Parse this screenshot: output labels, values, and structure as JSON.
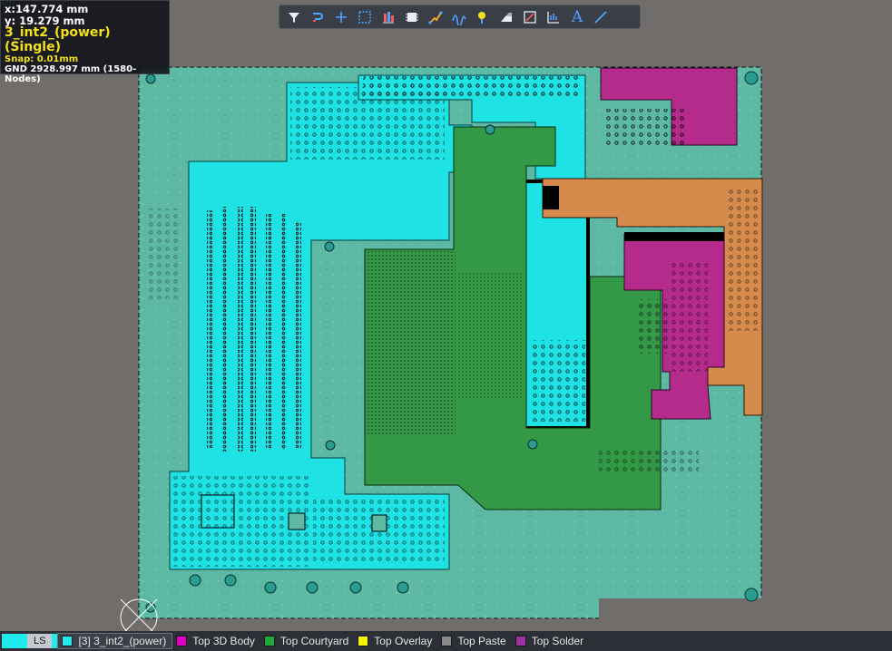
{
  "hud": {
    "x": "x:147.774 mm",
    "y": "y: 19.279  mm",
    "layer": "3_int2_(power) (Single)",
    "snap": "Snap: 0.01mm",
    "net": "GND  2928.997 mm  (1580-Nodes)"
  },
  "toolbar": {
    "items": [
      {
        "icon": "filter-icon"
      },
      {
        "icon": "route-icon"
      },
      {
        "icon": "crosshair-icon"
      },
      {
        "icon": "select-rect-icon"
      },
      {
        "icon": "align-icon"
      },
      {
        "icon": "component-icon"
      },
      {
        "icon": "interactive-route-icon"
      },
      {
        "icon": "diff-pair-icon"
      },
      {
        "icon": "place-via-icon"
      },
      {
        "icon": "polygon-icon"
      },
      {
        "icon": "dimension-icon"
      },
      {
        "icon": "graph-icon"
      },
      {
        "icon": "text-icon"
      },
      {
        "icon": "line-icon"
      }
    ],
    "text_icon_glyph": "A"
  },
  "statusbar": {
    "ls_label": "LS",
    "tabs": [
      {
        "label": "[3] 3_int2_(power)",
        "color": "#20ebea",
        "active": true
      },
      {
        "label": "Top 3D Body",
        "color": "#e000c8"
      },
      {
        "label": "Top Courtyard",
        "color": "#22a83a"
      },
      {
        "label": "Top Overlay",
        "color": "#f7f000"
      },
      {
        "label": "Top Paste",
        "color": "#8a8a8a"
      },
      {
        "label": "Top Solder",
        "color": "#a02fa0"
      }
    ]
  },
  "colors": {
    "background": "#706d6a",
    "board": "#5eb9a4",
    "power_cyan": "#1fe2e4",
    "courtyard_green": "#349947",
    "orange": "#d68a4b",
    "magenta": "#b52b8c"
  }
}
